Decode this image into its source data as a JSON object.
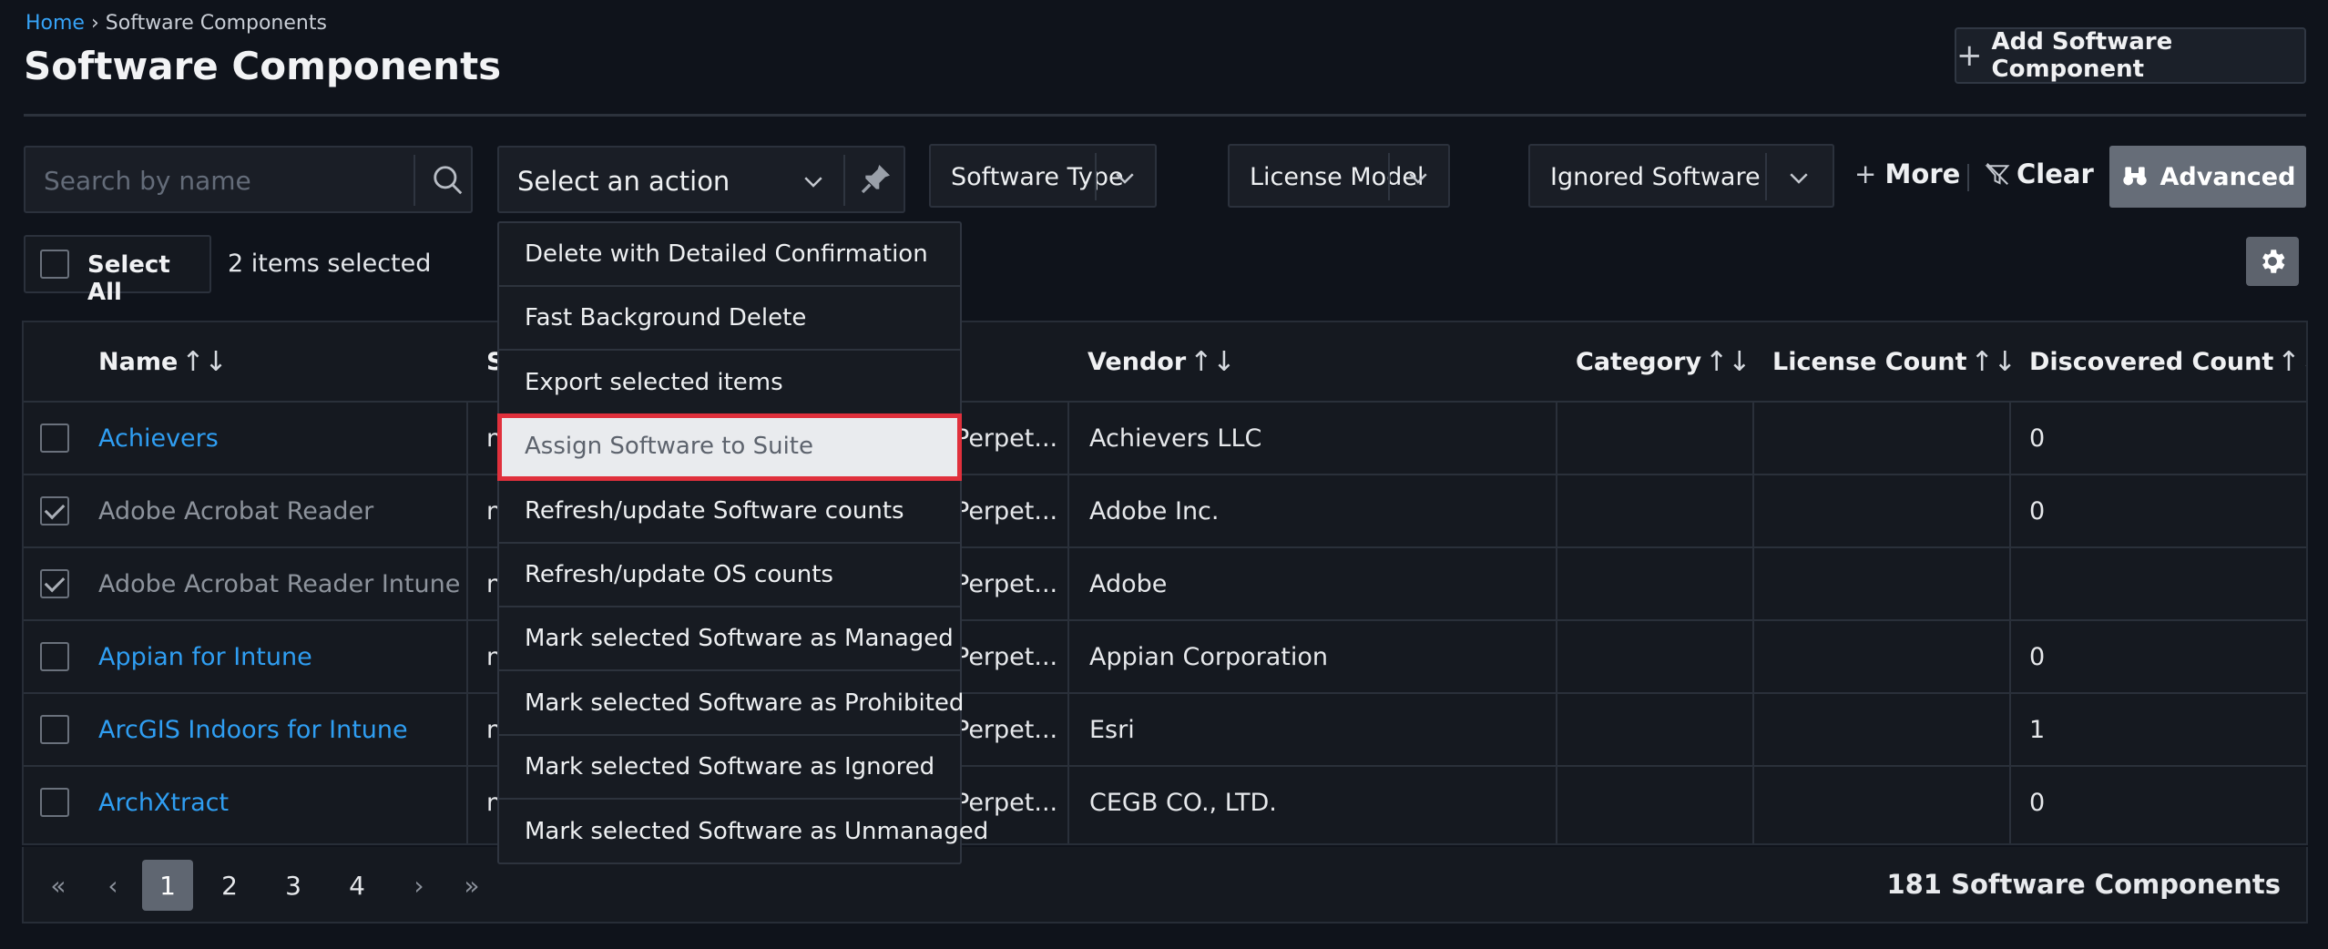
{
  "breadcrumb": {
    "home": "Home",
    "separator": "›",
    "current": "Software Components"
  },
  "page": {
    "title": "Software Components",
    "add_button": "Add Software Component"
  },
  "toolbar": {
    "search_placeholder": "Search by name",
    "action_select": "Select an action",
    "filters": [
      "Software Type",
      "License Model",
      "Ignored Software"
    ],
    "more": "More",
    "clear": "Clear",
    "advanced": "Advanced"
  },
  "selection": {
    "select_all": "Select All",
    "selected_count": "2 items selected"
  },
  "table": {
    "headers": {
      "name": "Name",
      "type": "S",
      "vendor": "Vendor",
      "category": "Category",
      "license_count": "License Count",
      "discovered_count": "Discovered Count"
    },
    "sort_glyph": "↑↓",
    "rows": [
      {
        "name": "Achievers",
        "checked": false,
        "link": true,
        "type": "n",
        "license_model": "Perpet...",
        "vendor": "Achievers LLC",
        "category": "",
        "license_count": "",
        "discovered": "0"
      },
      {
        "name": "Adobe Acrobat Reader",
        "checked": true,
        "link": false,
        "type": "n",
        "license_model": "Perpet...",
        "vendor": "Adobe Inc.",
        "category": "",
        "license_count": "",
        "discovered": "0"
      },
      {
        "name": "Adobe Acrobat Reader Intune",
        "checked": true,
        "link": false,
        "type": "n",
        "license_model": "Perpet...",
        "vendor": "Adobe",
        "category": "",
        "license_count": "",
        "discovered": ""
      },
      {
        "name": "Appian for Intune",
        "checked": false,
        "link": true,
        "type": "n",
        "license_model": "Perpet...",
        "vendor": "Appian Corporation",
        "category": "",
        "license_count": "",
        "discovered": "0"
      },
      {
        "name": "ArcGIS Indoors for Intune",
        "checked": false,
        "link": true,
        "type": "n",
        "license_model": "Perpet...",
        "vendor": "Esri",
        "category": "",
        "license_count": "",
        "discovered": "1"
      },
      {
        "name": "ArchXtract",
        "checked": false,
        "link": true,
        "type": "n",
        "license_model": "Perpet...",
        "vendor": "CEGB CO., LTD.",
        "category": "",
        "license_count": "",
        "discovered": "0"
      }
    ]
  },
  "pagination": {
    "first": "«",
    "prev": "‹",
    "pages": [
      "1",
      "2",
      "3",
      "4"
    ],
    "next": "›",
    "last": "»",
    "total": "181 Software Components"
  },
  "action_menu": {
    "items": [
      "Delete with Detailed Confirmation",
      "Fast Background Delete",
      "Export selected items",
      "Assign Software to Suite",
      "Refresh/update Software counts",
      "Refresh/update OS counts",
      "Mark selected Software as Managed",
      "Mark selected Software as Prohibited",
      "Mark selected Software as Ignored",
      "Mark selected Software as Unmanaged"
    ],
    "highlighted_index": 3
  },
  "colors": {
    "background": "#0f131b",
    "link": "#2f9ef2",
    "highlight_outline": "#e0303c",
    "advanced_button": "#666d78"
  }
}
